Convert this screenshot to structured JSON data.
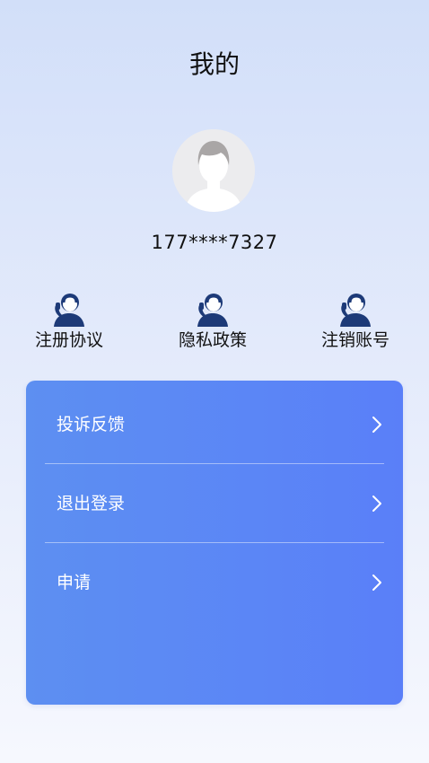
{
  "header": {
    "title": "我的"
  },
  "profile": {
    "avatar_icon": "default-user-avatar-icon",
    "phone": "177****7327"
  },
  "quick_links": [
    {
      "label": "注册协议",
      "icon": "customer-service-icon"
    },
    {
      "label": "隐私政策",
      "icon": "customer-service-icon"
    },
    {
      "label": "注销账号",
      "icon": "customer-service-icon"
    }
  ],
  "menu": {
    "items": [
      {
        "label": "投诉反馈",
        "icon": "chevron-right-icon"
      },
      {
        "label": "退出登录",
        "icon": "chevron-right-icon"
      },
      {
        "label": "申请",
        "icon": "chevron-right-icon"
      }
    ]
  },
  "colors": {
    "accent": "#5b86f6",
    "icon_navy": "#1d3a78",
    "background_top": "#d2dff9",
    "background_bottom": "#f6f8fe"
  }
}
